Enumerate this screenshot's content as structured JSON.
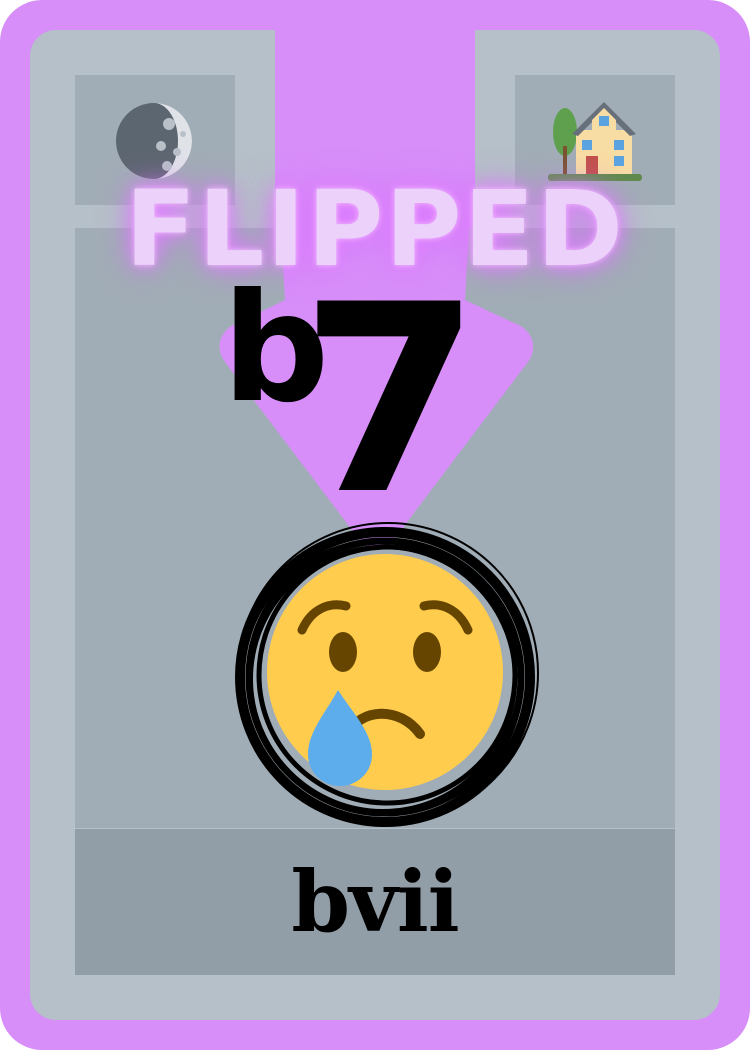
{
  "card": {
    "banner": "FLIPPED",
    "numeral_flat": "b",
    "numeral_degree": "7",
    "chord_name": "bvii"
  },
  "icons": {
    "top_left": "moon-icon",
    "top_right": "house-icon",
    "center": "sad-but-relieved-face-icon"
  },
  "colors": {
    "card_border": "#d78ef9",
    "frame": "#b5c0c8",
    "panel": "#a1adb6",
    "label_bar": "#929ea7",
    "banner_glow": "#e586ff"
  }
}
